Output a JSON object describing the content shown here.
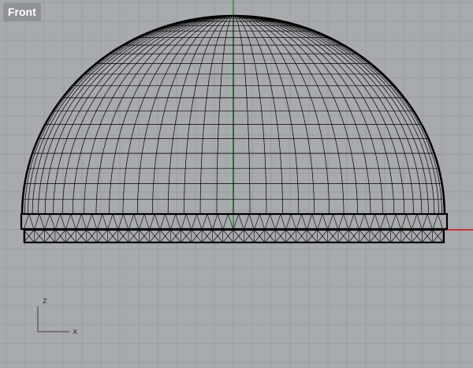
{
  "viewport": {
    "title": "Front",
    "background": "#a8abae",
    "grid_color": "#999ca0",
    "x_axis_color": "#d01010",
    "z_axis_color": "#10a010",
    "wire_color": "#000000"
  },
  "axis_indicator": {
    "z_label": "z",
    "x_label": "x"
  }
}
